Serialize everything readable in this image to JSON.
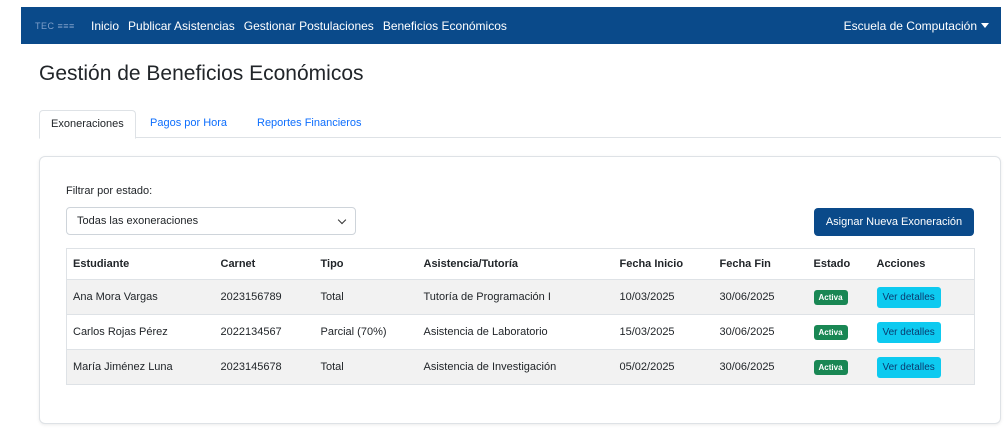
{
  "nav": {
    "brand": "TEC ≡≡≡",
    "links": [
      "Inicio",
      "Publicar Asistencias",
      "Gestionar Postulaciones",
      "Beneficios Económicos"
    ],
    "user_menu": "Escuela de Computación"
  },
  "page": {
    "title": "Gestión de Beneficios Económicos"
  },
  "tabs": [
    "Exoneraciones",
    "Pagos por Hora",
    "Reportes Financieros"
  ],
  "filter": {
    "label": "Filtrar por estado:",
    "selected": "Todas las exoneraciones"
  },
  "actions": {
    "assign_button": "Asignar Nueva Exoneración"
  },
  "table": {
    "headers": [
      "Estudiante",
      "Carnet",
      "Tipo",
      "Asistencia/Tutoría",
      "Fecha Inicio",
      "Fecha Fin",
      "Estado",
      "Acciones"
    ],
    "rows": [
      {
        "student": "Ana Mora Vargas",
        "carnet": "2023156789",
        "type": "Total",
        "assistance": "Tutoría de Programación I",
        "start": "10/03/2025",
        "end": "30/06/2025",
        "status": "Activa",
        "action": "Ver detalles"
      },
      {
        "student": "Carlos Rojas Pérez",
        "carnet": "2022134567",
        "type": "Parcial (70%)",
        "assistance": "Asistencia de Laboratorio",
        "start": "15/03/2025",
        "end": "30/06/2025",
        "status": "Activa",
        "action": "Ver detalles"
      },
      {
        "student": "María Jiménez Luna",
        "carnet": "2023145678",
        "type": "Total",
        "assistance": "Asistencia de Investigación",
        "start": "05/02/2025",
        "end": "30/06/2025",
        "status": "Activa",
        "action": "Ver detalles"
      }
    ]
  },
  "colors": {
    "navbar": "#0a4a8a",
    "primary_button": "#0a4a8a",
    "status_badge": "#198754",
    "detail_button": "#0dcaf0",
    "tab_link": "#0d6efd"
  }
}
